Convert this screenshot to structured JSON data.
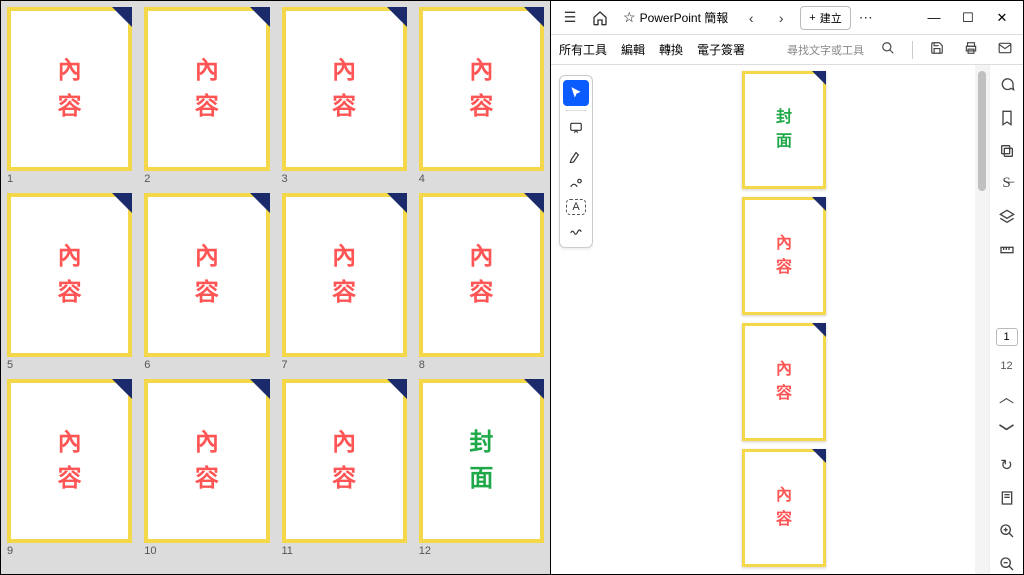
{
  "leftGrid": {
    "contentLabel": "內\n容",
    "coverLabel": "封\n面",
    "items": [
      {
        "num": "1",
        "type": "content"
      },
      {
        "num": "2",
        "type": "content"
      },
      {
        "num": "3",
        "type": "content"
      },
      {
        "num": "4",
        "type": "content"
      },
      {
        "num": "5",
        "type": "content"
      },
      {
        "num": "6",
        "type": "content"
      },
      {
        "num": "7",
        "type": "content"
      },
      {
        "num": "8",
        "type": "content"
      },
      {
        "num": "9",
        "type": "content"
      },
      {
        "num": "10",
        "type": "content"
      },
      {
        "num": "11",
        "type": "content"
      },
      {
        "num": "12",
        "type": "cover"
      }
    ]
  },
  "titleBar": {
    "tabLabel": "PowerPoint 簡報",
    "createLabel": "建立"
  },
  "menuBar": {
    "allTools": "所有工具",
    "edit": "編輯",
    "convert": "轉換",
    "esign": "電子簽署",
    "searchHint": "尋找文字或工具"
  },
  "rightTools": {
    "currentPage": "1",
    "totalPages": "12"
  },
  "pageStack": {
    "items": [
      {
        "type": "cover"
      },
      {
        "type": "content"
      },
      {
        "type": "content"
      },
      {
        "type": "content"
      }
    ]
  }
}
